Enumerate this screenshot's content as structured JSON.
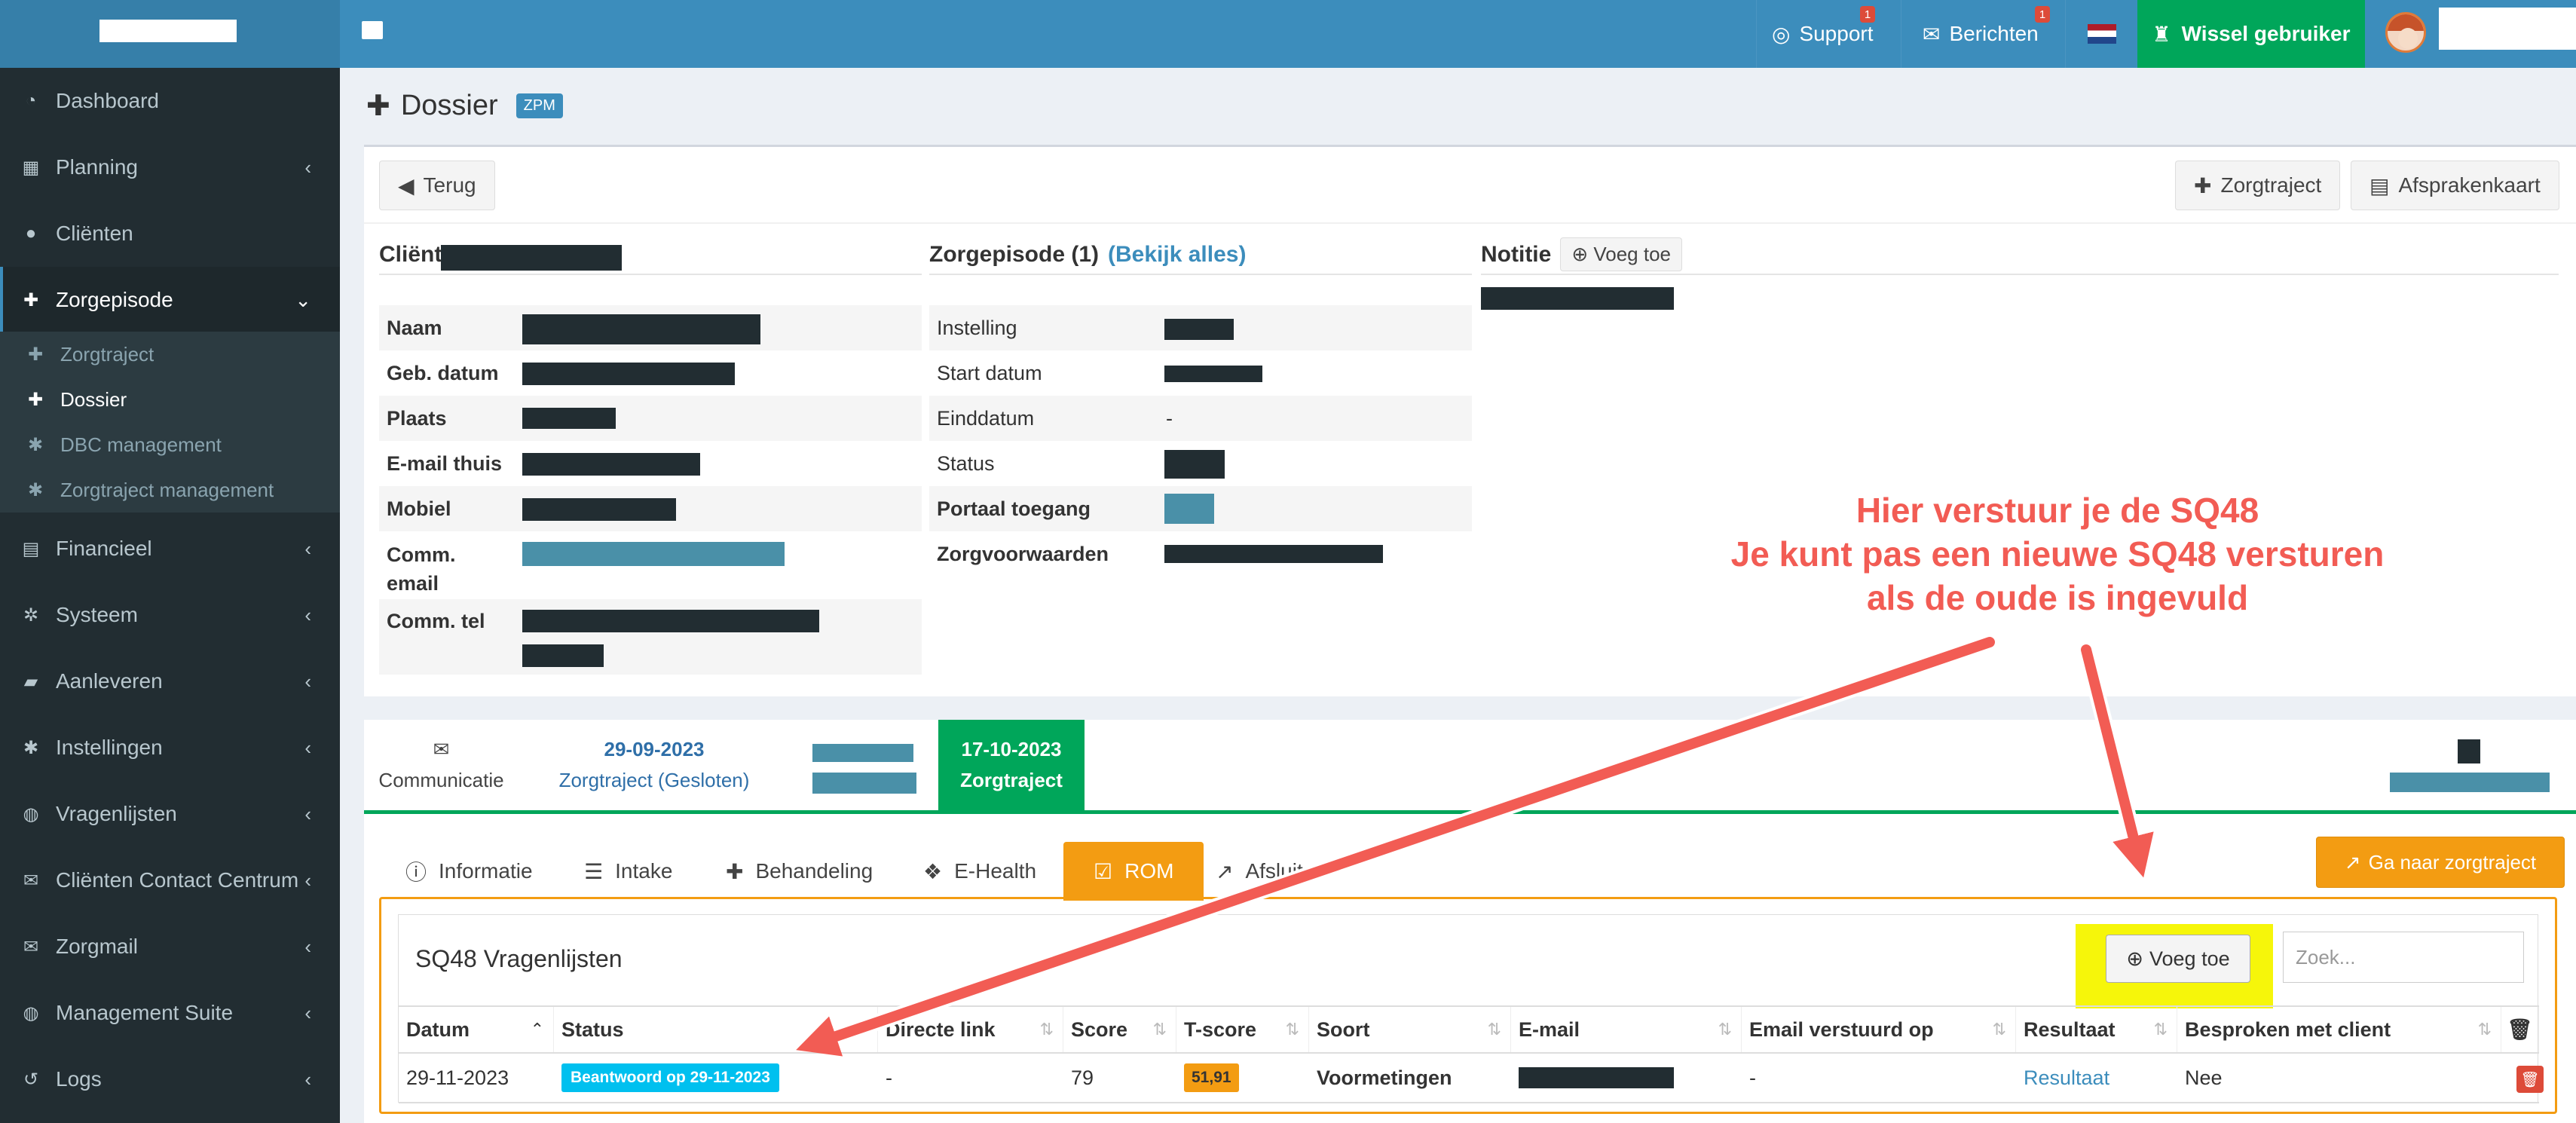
{
  "topbar": {
    "support_label": "Support",
    "support_badge": "1",
    "berichten_label": "Berichten",
    "berichten_badge": "1",
    "wissel_label": "Wissel gebruiker"
  },
  "sidebar": {
    "items": [
      {
        "label": "Dashboard",
        "icon": "dashboard-icon"
      },
      {
        "label": "Planning",
        "icon": "calendar-icon"
      },
      {
        "label": "Cliënten",
        "icon": "user-icon"
      },
      {
        "label": "Zorgepisode",
        "icon": "medkit-icon"
      },
      {
        "label": "Financieel",
        "icon": "book-icon"
      },
      {
        "label": "Systeem",
        "icon": "cogs-icon"
      },
      {
        "label": "Aanleveren",
        "icon": "truck-icon"
      },
      {
        "label": "Instellingen",
        "icon": "gear-icon"
      },
      {
        "label": "Vragenlijsten",
        "icon": "globe-icon"
      },
      {
        "label": "Cliënten Contact Centrum",
        "icon": "envelope-icon"
      },
      {
        "label": "Zorgmail",
        "icon": "envelope-icon"
      },
      {
        "label": "Management Suite",
        "icon": "globe-icon"
      },
      {
        "label": "Logs",
        "icon": "history-icon"
      }
    ],
    "subitems": [
      {
        "label": "Zorgtraject"
      },
      {
        "label": "Dossier"
      },
      {
        "label": "DBC management"
      },
      {
        "label": "Zorgtraject management"
      }
    ]
  },
  "page": {
    "title": "Dossier",
    "badge": "ZPM",
    "back_label": "Terug",
    "zorgtraject_label": "Zorgtraject",
    "afsprakenkaart_label": "Afsprakenkaart"
  },
  "client": {
    "heading": "Cliënt",
    "fields": [
      "Naam",
      "Geb. datum",
      "Plaats",
      "E-mail thuis",
      "Mobiel",
      "Comm. email",
      "Comm. tel"
    ]
  },
  "episode": {
    "heading": "Zorgepisode (1)",
    "link": "(Bekijk alles)",
    "fields": [
      "Instelling",
      "Start datum",
      "Einddatum",
      "Status",
      "Portaal toegang",
      "Zorgvoorwaarden"
    ],
    "einddatum_value": "-"
  },
  "notitie": {
    "heading": "Notitie",
    "add_label": "Voeg toe"
  },
  "lower": {
    "tab_comm": "Communicatie",
    "tab_old_date": "29-09-2023",
    "tab_old_label": "Zorgtraject (Gesloten)",
    "tab_active_date": "17-10-2023",
    "tab_active_label": "Zorgtraject",
    "subtabs": [
      "Informatie",
      "Intake",
      "Behandeling",
      "E-Health",
      "ROM",
      "Afsluiten"
    ],
    "ga_label": "Ga naar zorgtraject"
  },
  "table": {
    "title": "SQ48 Vragenlijsten",
    "add_label": "Voeg toe",
    "search_placeholder": "Zoek...",
    "headers": [
      "Datum",
      "Status",
      "Directe link",
      "Score",
      "T-score",
      "Soort",
      "E-mail",
      "Email verstuurd op",
      "Resultaat",
      "Besproken met client"
    ],
    "row": {
      "datum": "29-11-2023",
      "status": "Beantwoord op 29-11-2023",
      "link": "-",
      "score": "79",
      "tscore": "51,91",
      "soort": "Voormetingen",
      "verstuurd": "-",
      "resultaat": "Resultaat",
      "besproken": "Nee"
    }
  },
  "annotation": {
    "line1": "Hier verstuur je de SQ48",
    "line2": "Je kunt pas een nieuwe SQ48 versturen",
    "line3": "als de oude is ingevuld",
    "color": "#f25c54"
  }
}
